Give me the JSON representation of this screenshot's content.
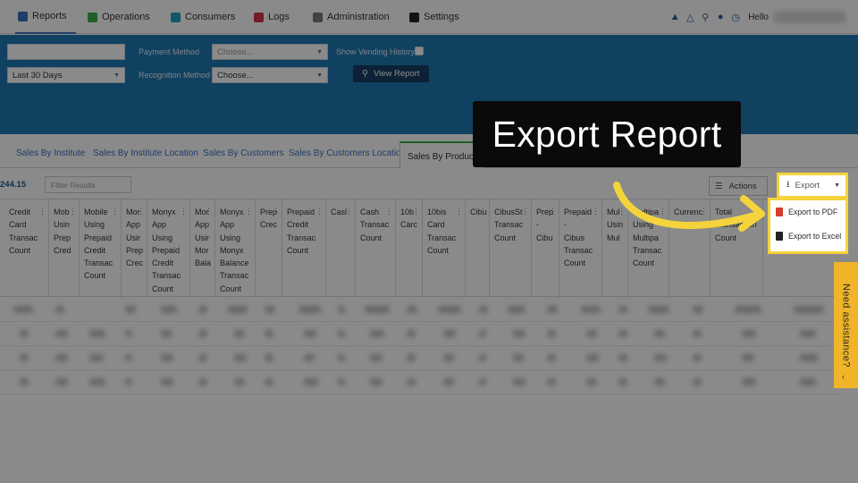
{
  "nav": {
    "items": [
      {
        "label": "Reports",
        "icon": "chart-icon",
        "color": "#3a6fc4"
      },
      {
        "label": "Operations",
        "icon": "operations-icon",
        "color": "#3fae49"
      },
      {
        "label": "Consumers",
        "icon": "consumers-icon",
        "color": "#1fa3c4"
      },
      {
        "label": "Logs",
        "icon": "logs-icon",
        "color": "#d9334a"
      },
      {
        "label": "Administration",
        "icon": "administration-icon",
        "color": "#7a7a7a"
      },
      {
        "label": "Settings",
        "icon": "settings-icon",
        "color": "#222222"
      }
    ],
    "hello": "Hello"
  },
  "filters": {
    "date_range": "Last 30 Days",
    "payment_method_label": "Payment Method",
    "payment_method_value": "Choose...",
    "recognition_method_label": "Recognition Method",
    "recognition_method_value": "Choose...",
    "show_vending_label": "Show Vending History",
    "view_report": "View Report"
  },
  "tabs": [
    "Sales By Institute",
    "Sales By Institute Location",
    "Sales By Customers",
    "Sales By Customers Location",
    "Sales By Product"
  ],
  "toolbar": {
    "total": "244.15",
    "filter_placeholder": "Filter Results",
    "actions": "Actions",
    "export": "Export"
  },
  "export_menu": {
    "pdf": "Export to PDF",
    "excel": "Export to Excel"
  },
  "columns": [
    "Credit\nCard\nTransac\nCount",
    "Mob\nUsin\nPrep\nCred",
    "Mobile\nUsing\nPrepaid\nCredit\nTransac\nCount",
    "Mor\nApp\nUsir\nPrep\nCrec",
    "Monyx\nApp\nUsing\nPrepaid\nCredit\nTransac\nCount",
    "Mor\nApp\nUsir\nMor\nBala",
    "Monyx\nApp\nUsing\nMonyx\nBalance\nTransac\nCount",
    "Prep\nCrec",
    "Prepaid\nCredit\nTransac\nCount",
    "Casl",
    "Cash\nTransac\nCount",
    "10b\nCarc",
    "10bis\nCard\nTransac\nCount",
    "Cibu",
    "CibusSt\nTransac\nCount",
    "Prep\n-\nCibu",
    "Prepaid\n-\nCibus\nTransac\nCount",
    "Mul\nUsin\nMul",
    "Multipa\nUsing\nMultipa\nTransac\nCount",
    "Currenc",
    "Total\nTransaction\nCount"
  ],
  "callout": "Export Report",
  "assistance": "Need assistance?"
}
